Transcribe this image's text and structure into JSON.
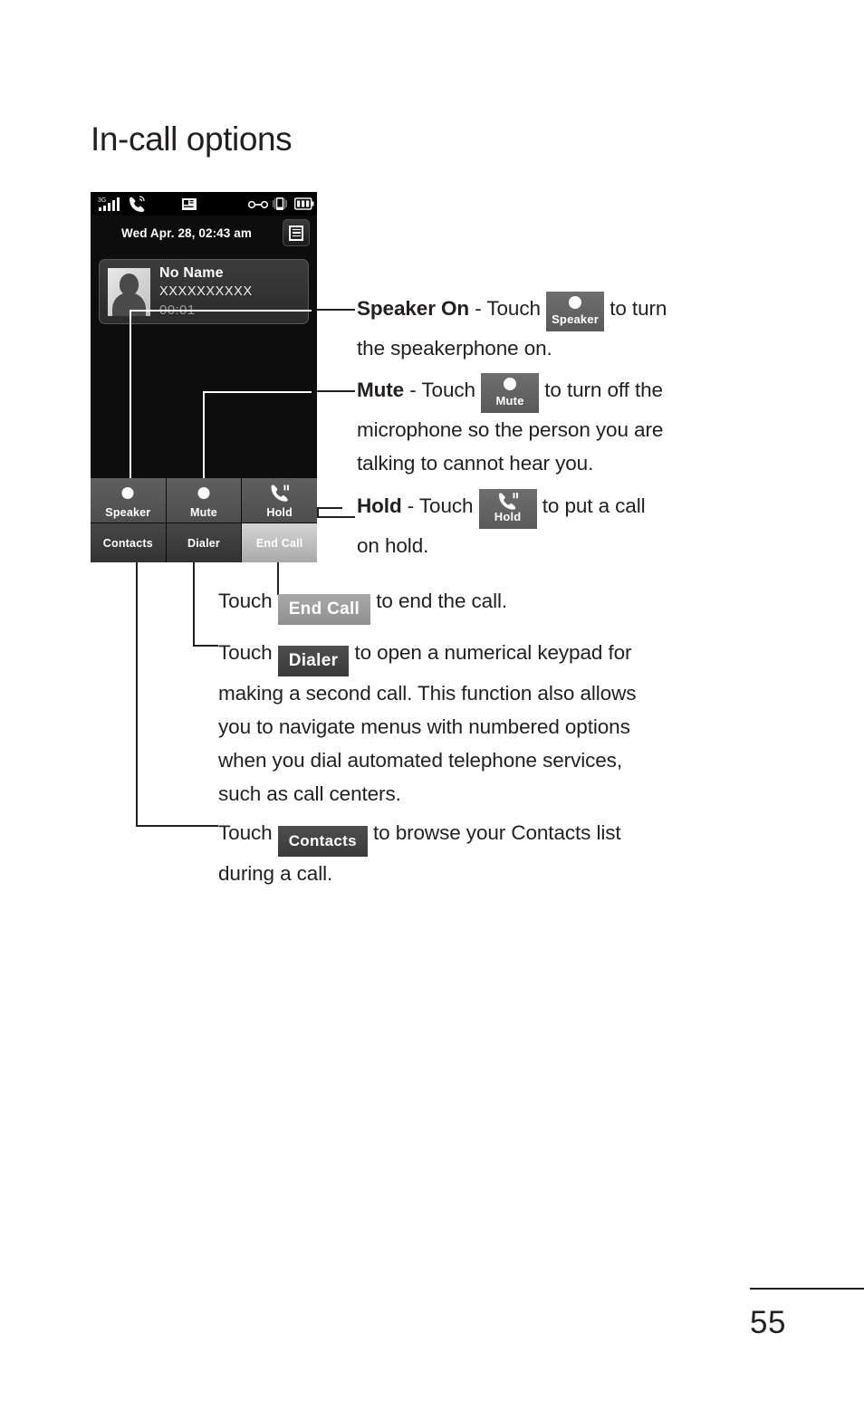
{
  "page": {
    "title": "In-call options",
    "number": "55"
  },
  "phone": {
    "statusbar": {
      "network_label": "3G",
      "icons": [
        "signal-bars-icon",
        "ringer-icon",
        "app-icon",
        "handset-off-icon",
        "vibrate-icon",
        "battery-icon"
      ]
    },
    "datetime": "Wed Apr. 28, 02:43 am",
    "menu_button_label": "menu-icon",
    "contact": {
      "name": "No Name",
      "number": "XXXXXXXXXX",
      "timer": "00:01"
    },
    "buttons": [
      {
        "id": "speaker",
        "label": "Speaker",
        "icon": "dot-icon",
        "style": "normal"
      },
      {
        "id": "mute",
        "label": "Mute",
        "icon": "dot-icon",
        "style": "normal"
      },
      {
        "id": "hold",
        "label": "Hold",
        "icon": "hold-icon",
        "style": "normal"
      },
      {
        "id": "contacts",
        "label": "Contacts",
        "icon": "",
        "style": "dark"
      },
      {
        "id": "dialer",
        "label": "Dialer",
        "icon": "",
        "style": "dark"
      },
      {
        "id": "endcall",
        "label": "End Call",
        "icon": "",
        "style": "light"
      }
    ]
  },
  "annotations": {
    "speaker": {
      "term": "Speaker On",
      "dash": " - ",
      "touch": "Touch ",
      "chip_label": "Speaker",
      "after": " to turn",
      "line2": "the speakerphone on."
    },
    "mute": {
      "term": "Mute",
      "dash": " - ",
      "touch": "Touch ",
      "chip_label": "Mute",
      "after": " to turn off the",
      "line2": "microphone so the person you are",
      "line3": "talking to cannot hear you."
    },
    "hold": {
      "term": "Hold",
      "dash": " - ",
      "touch": "Touch ",
      "chip_label": "Hold",
      "after": " to put a call",
      "line2": "on hold."
    },
    "endcall": {
      "touch": "Touch ",
      "chip_label": "End Call",
      "after": " to end the call."
    },
    "dialer": {
      "touch": "Touch ",
      "chip_label": "Dialer",
      "after": " to open a numerical keypad for",
      "line2": "making a second call. This function also allows",
      "line3": "you to navigate menus with numbered options",
      "line4": "when you dial automated telephone services,",
      "line5": "such as call centers."
    },
    "contacts": {
      "touch": "Touch ",
      "chip_label": "Contacts",
      "after": " to browse your Contacts list",
      "line2": "during a call."
    }
  },
  "colors": {
    "ink": "#231f20",
    "phone_bg": "#0d0d0d",
    "button_gray": "#565656",
    "endcall_gray": "#a9a9a9"
  }
}
